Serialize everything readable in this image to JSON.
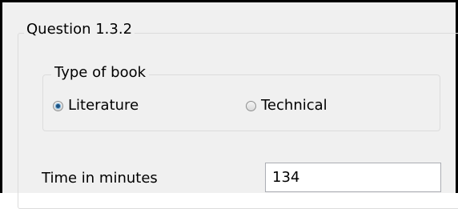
{
  "outer_group": {
    "legend": "Question 1.3.2"
  },
  "book_type_group": {
    "legend": "Type of book",
    "options": [
      {
        "label": "Literature",
        "checked": true
      },
      {
        "label": "Technical",
        "checked": false
      }
    ]
  },
  "time": {
    "label": "Time in minutes",
    "value": "134"
  }
}
